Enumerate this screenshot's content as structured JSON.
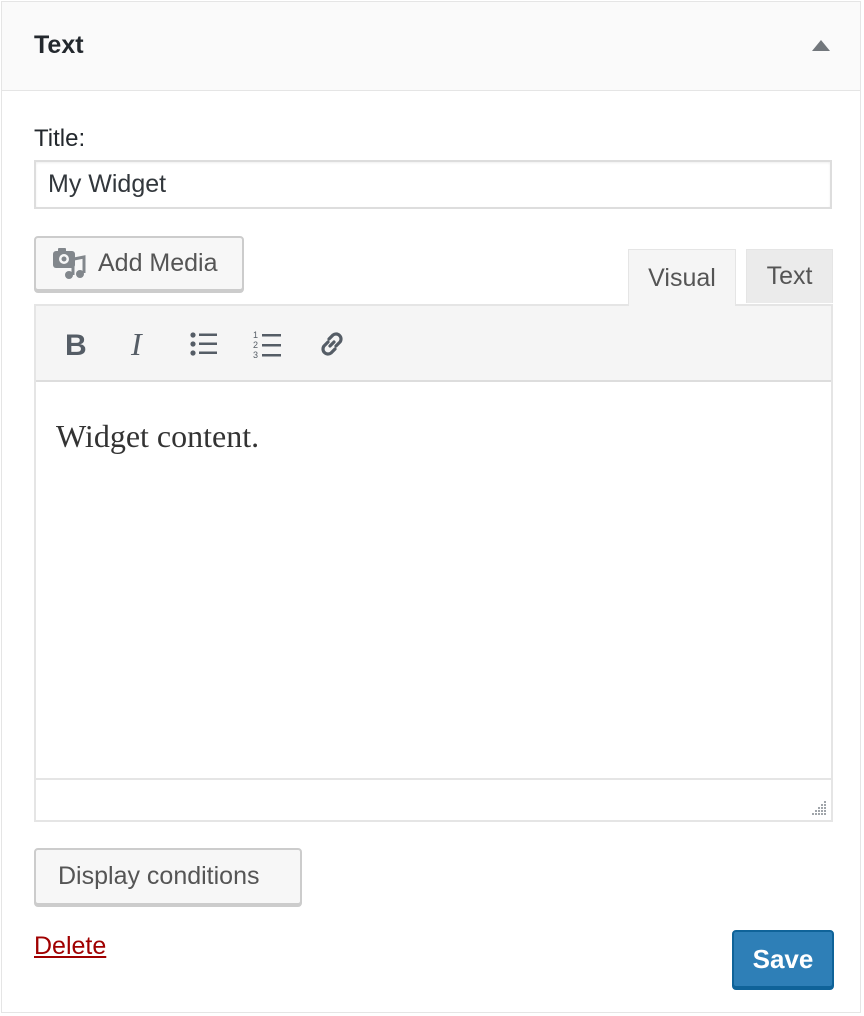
{
  "widget": {
    "title": "Text"
  },
  "form": {
    "title_label": "Title:",
    "title_value": "My Widget"
  },
  "editor": {
    "add_media_label": "Add Media",
    "tabs": [
      {
        "label": "Visual",
        "active": true
      },
      {
        "label": "Text",
        "active": false
      }
    ],
    "toolbar_icons": [
      "bold-icon",
      "italic-icon",
      "bulleted-list-icon",
      "numbered-list-icon",
      "link-icon"
    ],
    "content": "Widget content."
  },
  "actions": {
    "display_conditions_label": "Display conditions",
    "delete_label": "Delete",
    "save_label": "Save"
  },
  "colors": {
    "primary_button": "#2e7fb7",
    "delete_link": "#a00000"
  }
}
